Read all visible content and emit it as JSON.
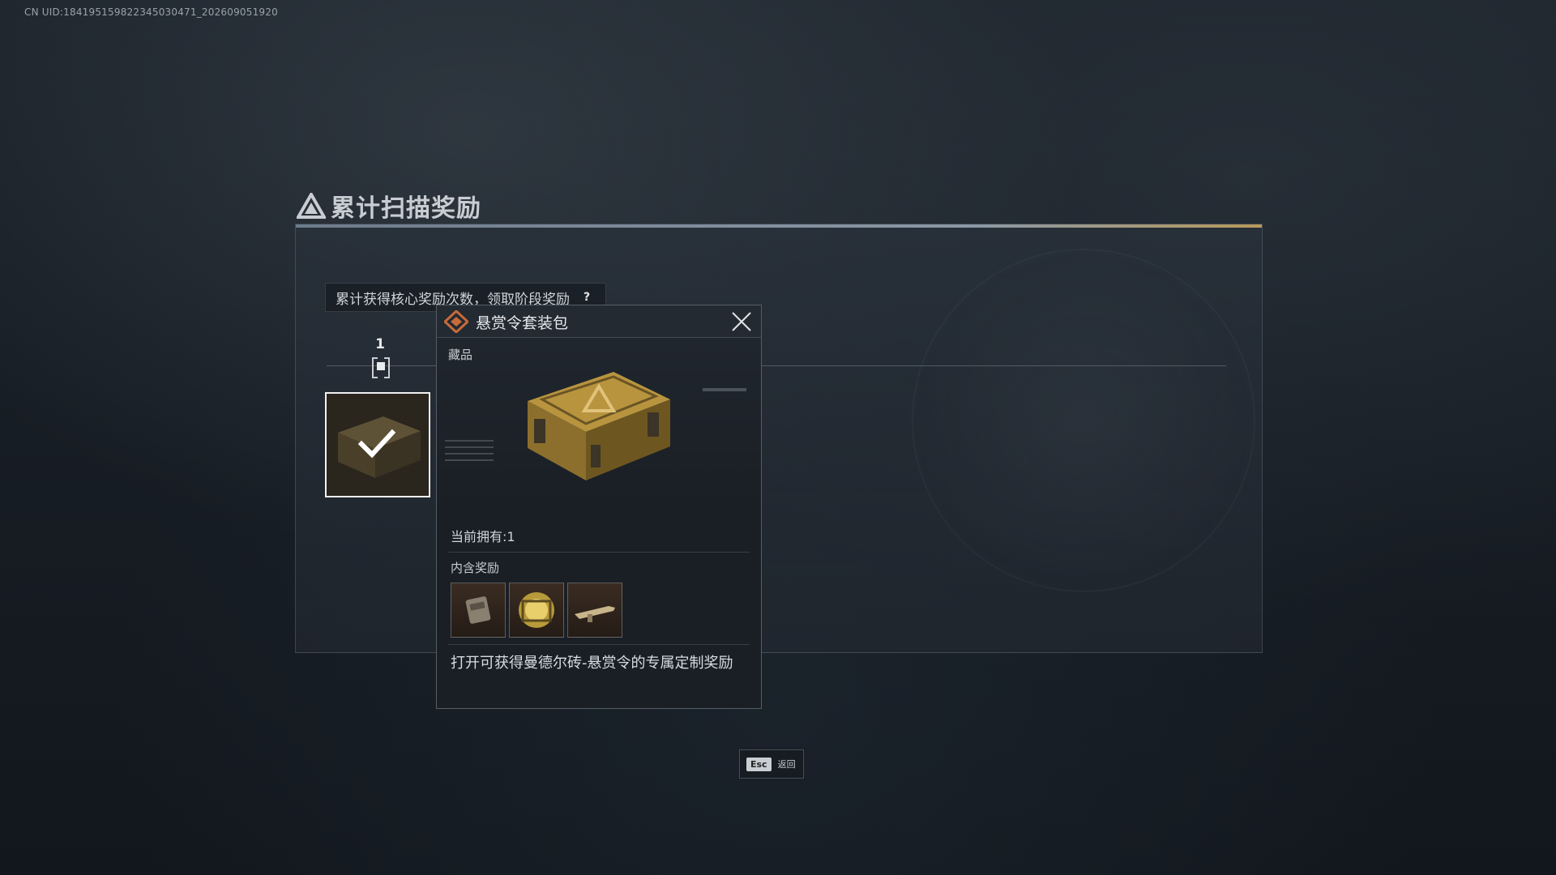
{
  "uid_text": "CN UID:1841951598223450304​71_202609051920",
  "panel": {
    "title": "累计扫描奖励",
    "info_text": "累计获得核心奖励次数，领取阶段奖励",
    "help_symbol": "?",
    "stages": [
      {
        "number": "1",
        "claimed": true
      }
    ]
  },
  "popup": {
    "title": "悬赏令套装包",
    "category_label": "藏品",
    "owned_label": "当前拥有:1",
    "contents_label": "内含奖励",
    "items": [
      {
        "icon": "gear-item-icon"
      },
      {
        "icon": "gold-pack-icon"
      },
      {
        "icon": "weapon-skin-icon"
      }
    ],
    "description": "打开可获得曼德尔砖-悬赏令的专属定制奖励"
  },
  "footer": {
    "esc_key": "Esc",
    "esc_label": "返回"
  },
  "colors": {
    "accent_gold": "#b8943f",
    "icon_orange": "#c86a3a"
  }
}
